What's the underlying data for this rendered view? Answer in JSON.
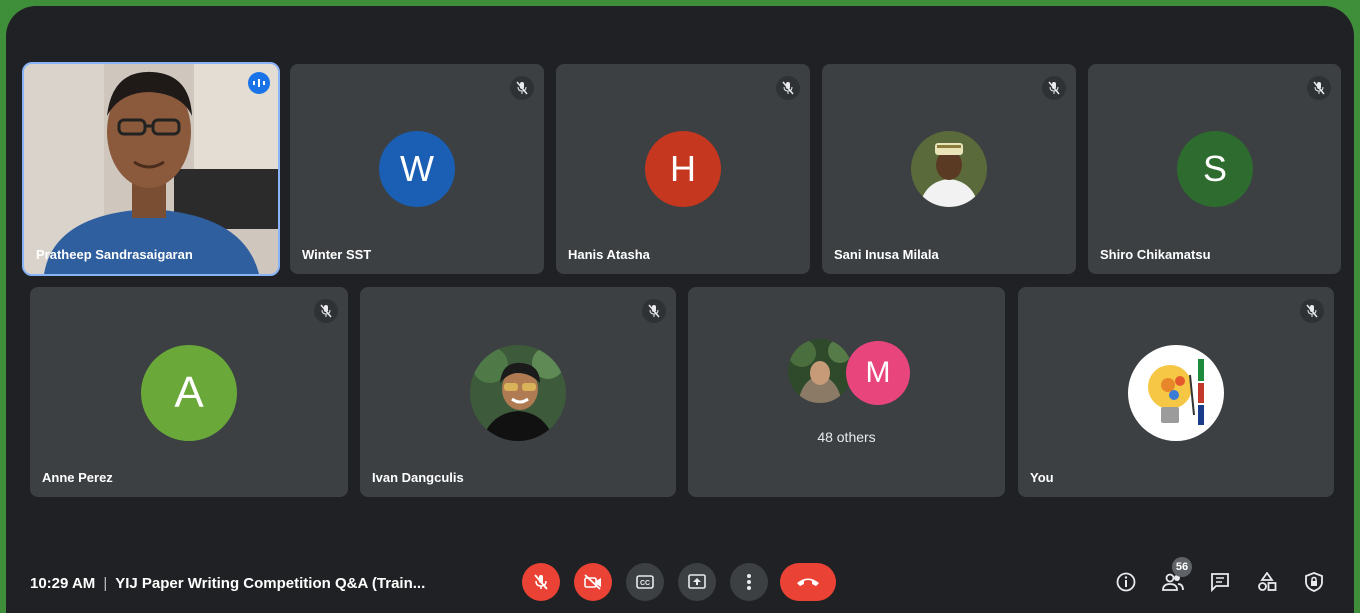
{
  "participants": [
    {
      "name": "Pratheep Sandrasaigaran"
    },
    {
      "name": "Winter SST",
      "initial": "W",
      "color": "#1a5fb4"
    },
    {
      "name": "Hanis Atasha",
      "initial": "H",
      "color": "#c5371f"
    },
    {
      "name": "Sani Inusa Milala"
    },
    {
      "name": "Shiro Chikamatsu",
      "initial": "S",
      "color": "#2e6b2f"
    },
    {
      "name": "Anne Perez",
      "initial": "A",
      "color": "#6aa83a"
    },
    {
      "name": "Ivan Dangculis"
    },
    {
      "name": "You"
    }
  ],
  "others": {
    "label": "48 others",
    "initial": "M",
    "color": "#e8457c"
  },
  "meeting": {
    "time": "10:29 AM",
    "separator": "|",
    "title": "YIJ Paper Writing Competition Q&A (Train..."
  },
  "controls": {
    "cc": "CC"
  },
  "people": {
    "count": "56"
  },
  "colors": {
    "tile": "#3c4043",
    "background": "#202124",
    "danger": "#ea4335",
    "accent": "#1a73e8"
  }
}
